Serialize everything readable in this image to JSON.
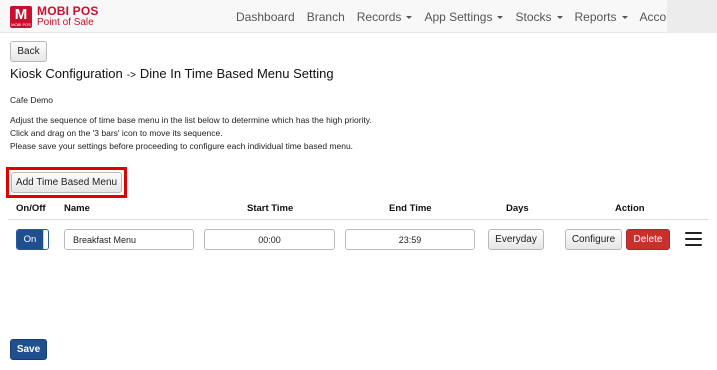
{
  "brand": {
    "logo_text": "M",
    "logo_sub": "MOBI POS",
    "title": "MOBI POS",
    "subtitle": "Point of Sale"
  },
  "nav": {
    "items": [
      {
        "label": "Dashboard",
        "dropdown": false
      },
      {
        "label": "Branch",
        "dropdown": false
      },
      {
        "label": "Records",
        "dropdown": true
      },
      {
        "label": "App Settings",
        "dropdown": true
      },
      {
        "label": "Stocks",
        "dropdown": true
      },
      {
        "label": "Reports",
        "dropdown": true
      },
      {
        "label": "Accounts",
        "dropdown": true
      }
    ]
  },
  "page": {
    "back_label": "Back",
    "title_main": "Kiosk Configuration",
    "title_arrow": "->",
    "title_sub": "Dine In Time Based Menu Setting",
    "company": "Cafe Demo",
    "instructions": [
      "Adjust the sequence of time base menu in the list below to determine which has the high priority.",
      "Click and drag on the '3 bars' icon to move its sequence.",
      "Please save your settings before proceeding to configure each individual time based menu."
    ],
    "add_label": "Add Time Based Menu",
    "save_label": "Save"
  },
  "table": {
    "headers": {
      "onoff": "On/Off",
      "name": "Name",
      "start": "Start Time",
      "end": "End Time",
      "days": "Days",
      "action": "Action"
    },
    "rows": [
      {
        "toggle": "On",
        "name": "Breakfast Menu",
        "start": "00:00",
        "end": "23:59",
        "days": "Everyday",
        "configure": "Configure",
        "delete": "Delete"
      }
    ]
  },
  "colors": {
    "brand_red": "#c8102e",
    "primary": "#1f4f8f",
    "danger": "#c9302c",
    "highlight": "#e00000"
  }
}
